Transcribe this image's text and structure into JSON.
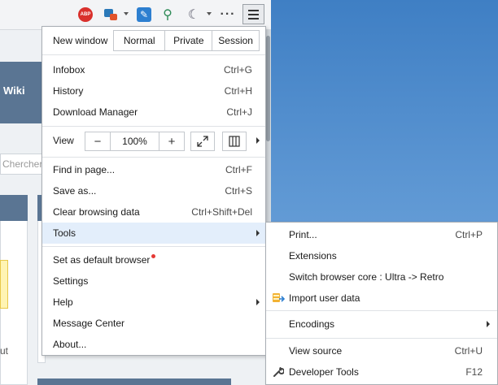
{
  "toolbar": {
    "abp_label": "ABP",
    "icons": [
      "adblock-icon",
      "feedback-icon",
      "tools-icon",
      "zoom-icon",
      "night-mode-icon",
      "more-icon",
      "hamburger-menu-icon"
    ]
  },
  "background_page": {
    "nav_tab_text": "Wiki",
    "search_placeholder": "Chercher",
    "cut_text": "ut"
  },
  "menu": {
    "new_window": {
      "label": "New window",
      "options": [
        "Normal",
        "Private",
        "Session"
      ]
    },
    "items_a": [
      {
        "label": "Infobox",
        "shortcut": "Ctrl+G"
      },
      {
        "label": "History",
        "shortcut": "Ctrl+H"
      },
      {
        "label": "Download Manager",
        "shortcut": "Ctrl+J"
      }
    ],
    "view": {
      "label": "View",
      "zoom_minus": "−",
      "zoom_value": "100%",
      "zoom_plus": "+"
    },
    "items_b": [
      {
        "label": "Find in page...",
        "shortcut": "Ctrl+F"
      },
      {
        "label": "Save as...",
        "shortcut": "Ctrl+S"
      },
      {
        "label": "Clear browsing data",
        "shortcut": "Ctrl+Shift+Del"
      },
      {
        "label": "Tools",
        "shortcut": ""
      }
    ],
    "items_c": [
      {
        "label": "Set as default browser",
        "shortcut": ""
      },
      {
        "label": "Settings",
        "shortcut": ""
      },
      {
        "label": "Help",
        "shortcut": ""
      },
      {
        "label": "Message Center",
        "shortcut": ""
      },
      {
        "label": "About...",
        "shortcut": ""
      }
    ]
  },
  "tools_submenu": {
    "items": [
      {
        "label": "Print...",
        "shortcut": "Ctrl+P"
      },
      {
        "label": "Extensions",
        "shortcut": ""
      },
      {
        "label": "Switch browser core : Ultra -> Retro",
        "shortcut": ""
      },
      {
        "label": "Import user data",
        "shortcut": ""
      },
      {
        "label": "Encodings",
        "shortcut": ""
      },
      {
        "label": "View source",
        "shortcut": "Ctrl+U"
      },
      {
        "label": "Developer Tools",
        "shortcut": "F12"
      }
    ]
  },
  "colors": {
    "menu_hover": "#e3eefb",
    "notification_dot": "#e53935",
    "desktop": "#5b95d2"
  }
}
